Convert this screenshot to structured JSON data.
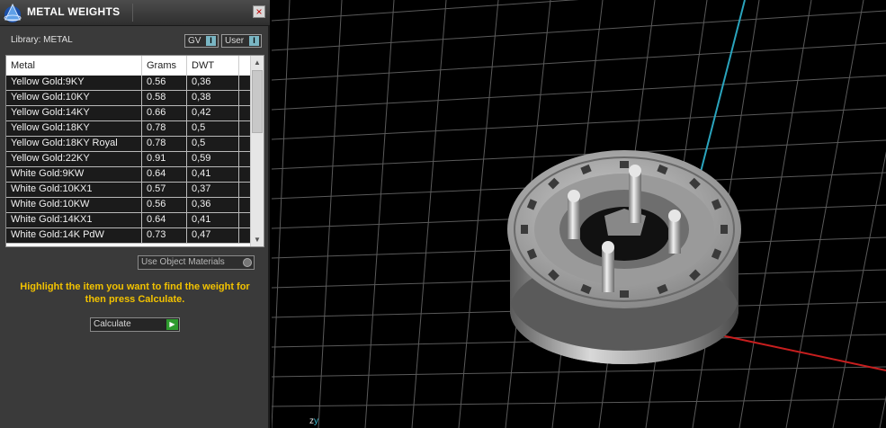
{
  "panel": {
    "title": "METAL WEIGHTS",
    "close_glyph": "×",
    "library_label": "Library: METAL",
    "toggles": [
      {
        "label": "GV",
        "switch": "I"
      },
      {
        "label": "User",
        "switch": "I"
      }
    ],
    "columns": [
      "Metal",
      "Grams",
      "DWT"
    ],
    "rows": [
      {
        "metal": "Yellow Gold:9KY",
        "grams": "0.56",
        "dwt": "0,36"
      },
      {
        "metal": "Yellow Gold:10KY",
        "grams": "0.58",
        "dwt": "0,38"
      },
      {
        "metal": "Yellow Gold:14KY",
        "grams": "0.66",
        "dwt": "0,42"
      },
      {
        "metal": "Yellow Gold:18KY",
        "grams": "0.78",
        "dwt": "0,5"
      },
      {
        "metal": "Yellow Gold:18KY Royal",
        "grams": "0.78",
        "dwt": "0,5"
      },
      {
        "metal": "Yellow Gold:22KY",
        "grams": "0.91",
        "dwt": "0,59"
      },
      {
        "metal": "White Gold:9KW",
        "grams": "0.64",
        "dwt": "0,41"
      },
      {
        "metal": "White Gold:10KX1",
        "grams": "0.57",
        "dwt": "0,37"
      },
      {
        "metal": "White Gold:10KW",
        "grams": "0.56",
        "dwt": "0,36"
      },
      {
        "metal": "White Gold:14KX1",
        "grams": "0.64",
        "dwt": "0,41"
      },
      {
        "metal": "White Gold:14K PdW",
        "grams": "0.73",
        "dwt": "0,47"
      }
    ],
    "use_object_materials": "Use Object Materials",
    "instruction": "Highlight the item you want to find the weight for then press Calculate.",
    "calculate_label": "Calculate",
    "scroll_up": "▲",
    "scroll_down": "▼",
    "calc_arrow": "▶"
  },
  "viewport": {
    "axis_z": "z",
    "axis_y": "y"
  },
  "colors": {
    "grid": "#5a5a5a",
    "y_axis": "#2aa4bd",
    "x_axis": "#c81e1e",
    "highlight_text": "#f2c200"
  },
  "icons": {
    "logo": "app-logo-icon",
    "close": "close-icon",
    "calculate": "play-arrow-icon"
  }
}
